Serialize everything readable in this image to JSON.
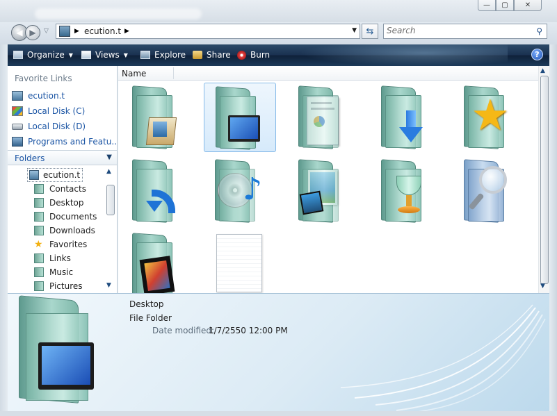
{
  "window": {
    "controls": {
      "minimize": "—",
      "maximize": "▢",
      "close": "✕"
    }
  },
  "address": {
    "path": "ecution.t",
    "search_placeholder": "Search",
    "icons": {
      "back": "back-arrow-icon",
      "forward": "forward-arrow-icon",
      "refresh": "refresh-icon",
      "search": "search-icon"
    }
  },
  "toolbar": {
    "organize": "Organize",
    "views": "Views",
    "explore": "Explore",
    "share": "Share",
    "burn": "Burn",
    "help": "?"
  },
  "navpane": {
    "favorite_links_title": "Favorite Links",
    "favorite_links": [
      {
        "label": "ecution.t",
        "icon": "user-folder-icon"
      },
      {
        "label": "Local Disk (C)",
        "icon": "windows-drive-icon"
      },
      {
        "label": "Local Disk (D)",
        "icon": "drive-icon"
      },
      {
        "label": "Programs and Featu...",
        "icon": "programs-icon"
      }
    ],
    "folders_header": "Folders",
    "tree_root": "ecution.t",
    "tree_items": [
      {
        "label": "Contacts",
        "icon": "contacts-icon"
      },
      {
        "label": "Desktop",
        "icon": "desktop-icon"
      },
      {
        "label": "Documents",
        "icon": "documents-icon"
      },
      {
        "label": "Downloads",
        "icon": "downloads-icon"
      },
      {
        "label": "Favorites",
        "icon": "favorites-icon"
      },
      {
        "label": "Links",
        "icon": "links-icon"
      },
      {
        "label": "Music",
        "icon": "music-icon"
      },
      {
        "label": "Pictures",
        "icon": "pictures-icon"
      }
    ]
  },
  "content": {
    "column_name": "Name",
    "tiles": [
      {
        "icon": "contacts-folder-icon",
        "selected": false
      },
      {
        "icon": "desktop-folder-icon",
        "selected": true
      },
      {
        "icon": "documents-folder-icon",
        "selected": false
      },
      {
        "icon": "downloads-folder-icon",
        "selected": false
      },
      {
        "icon": "favorites-folder-icon",
        "selected": false
      },
      {
        "icon": "links-folder-icon",
        "selected": false
      },
      {
        "icon": "music-folder-icon",
        "selected": false
      },
      {
        "icon": "pictures-folder-icon",
        "selected": false
      },
      {
        "icon": "saved-games-folder-icon",
        "selected": false
      },
      {
        "icon": "searches-folder-icon",
        "selected": false
      },
      {
        "icon": "videos-folder-icon",
        "selected": false
      },
      {
        "icon": "blank-file-icon",
        "selected": false
      }
    ]
  },
  "details": {
    "name": "Desktop",
    "type": "File Folder",
    "date_label": "Date modified:",
    "date_value": "1/7/2550 12:00 PM"
  }
}
